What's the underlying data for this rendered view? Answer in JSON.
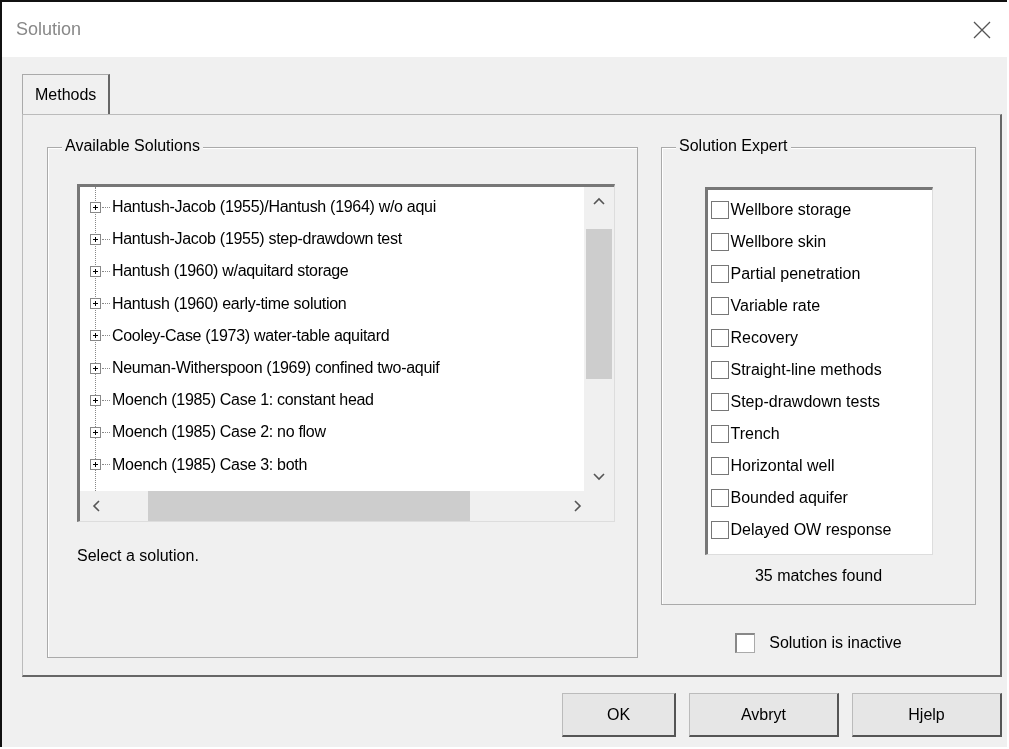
{
  "window": {
    "title": "Solution"
  },
  "tabs": [
    {
      "label": "Methods",
      "selected": true
    }
  ],
  "available_solutions": {
    "title": "Available Solutions",
    "tree": [
      {
        "label": "Hantush-Jacob (1955)/Hantush (1964) w/o aqui",
        "expanded": false
      },
      {
        "label": "Hantush-Jacob (1955) step-drawdown test",
        "expanded": false
      },
      {
        "label": "Hantush (1960) w/aquitard storage",
        "expanded": false
      },
      {
        "label": "Hantush (1960) early-time solution",
        "expanded": false
      },
      {
        "label": "Cooley-Case (1973) water-table aquitard",
        "expanded": false
      },
      {
        "label": "Neuman-Witherspoon (1969) confined two-aquif",
        "expanded": false
      },
      {
        "label": "Moench (1985) Case 1: constant head",
        "expanded": false
      },
      {
        "label": "Moench (1985) Case 2: no flow",
        "expanded": false
      },
      {
        "label": "Moench (1985) Case 3: both",
        "expanded": false
      }
    ],
    "hint": "Select a solution."
  },
  "solution_expert": {
    "title": "Solution Expert",
    "options": [
      {
        "label": "Wellbore storage",
        "checked": false
      },
      {
        "label": "Wellbore skin",
        "checked": false
      },
      {
        "label": "Partial penetration",
        "checked": false
      },
      {
        "label": "Variable rate",
        "checked": false
      },
      {
        "label": "Recovery",
        "checked": false
      },
      {
        "label": "Straight-line methods",
        "checked": false
      },
      {
        "label": "Step-drawdown tests",
        "checked": false
      },
      {
        "label": "Trench",
        "checked": false
      },
      {
        "label": "Horizontal well",
        "checked": false
      },
      {
        "label": "Bounded aquifer",
        "checked": false
      },
      {
        "label": "Delayed OW response",
        "checked": false
      }
    ],
    "matches": "35 matches found"
  },
  "inactive": {
    "label": "Solution is inactive",
    "checked": false
  },
  "buttons": [
    "OK",
    "Avbryt",
    "Hjelp"
  ]
}
